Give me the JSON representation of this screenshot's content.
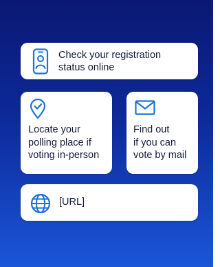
{
  "colors": {
    "background_top": "#0a1872",
    "background_bottom": "#1b55d8",
    "card": "#ffffff",
    "icon_accent": "#1a73d9",
    "text": "#141a3a"
  },
  "cards": {
    "registration": {
      "icon": "smartphone-user-icon",
      "line1": "Check your registration",
      "line2": "status online"
    },
    "polling": {
      "icon": "location-pin-check-icon",
      "line1": "Locate your",
      "line2": "polling place if",
      "line3": "voting in-person"
    },
    "mail": {
      "icon": "envelope-icon",
      "line1": "Find out",
      "line2": "if you can",
      "line3": "vote by mail"
    },
    "url": {
      "icon": "globe-icon",
      "label": "[URL]"
    }
  }
}
